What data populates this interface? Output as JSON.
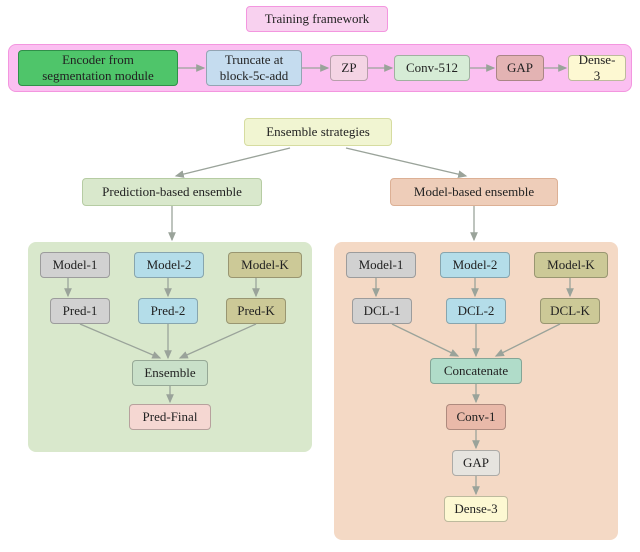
{
  "header": {
    "title": "Training framework"
  },
  "pipeline": {
    "encoder": "Encoder from\nsegmentation module",
    "truncate": "Truncate at\nblock-5c-add",
    "zp": "ZP",
    "conv512": "Conv-512",
    "gap": "GAP",
    "dense3": "Dense-3"
  },
  "strategies": {
    "title": "Ensemble strategies"
  },
  "pred_panel": {
    "title": "Prediction-based ensemble",
    "model1": "Model-1",
    "model2": "Model-2",
    "modelK": "Model-K",
    "pred1": "Pred-1",
    "pred2": "Pred-2",
    "predK": "Pred-K",
    "ensemble": "Ensemble",
    "predFinal": "Pred-Final"
  },
  "model_panel": {
    "title": "Model-based ensemble",
    "model1": "Model-1",
    "model2": "Model-2",
    "modelK": "Model-K",
    "dcl1": "DCL-1",
    "dcl2": "DCL-2",
    "dclK": "DCL-K",
    "concat": "Concatenate",
    "conv1": "Conv-1",
    "gap": "GAP",
    "dense3": "Dense-3"
  },
  "colors": {
    "pinkBg": "#f8d1ef",
    "pinkBorder": "#f396df",
    "violetBg": "#fbbff1",
    "green": "#4fc56a",
    "blue": "#c5dcef",
    "pinkLt": "#f4d4e4",
    "greenLt": "#d6ecd6",
    "salmon": "#e3b3b3",
    "tan": "#e0d7a5",
    "yellow": "#fdf8d2",
    "paleYellow": "#f1f5d2",
    "panelGreen": "#d9e8cc",
    "panelPeach": "#f4d9c5",
    "peachHdr": "#eecdb9",
    "grey": "#d1d1d1",
    "skyBlue": "#b4dde9",
    "olive": "#ccc997",
    "mint": "#c9e0c9",
    "lightPink": "#f5d7d2",
    "tealMint": "#b0dcc9",
    "salmon2": "#e9b9a9",
    "paleGrey": "#e6e4df"
  }
}
